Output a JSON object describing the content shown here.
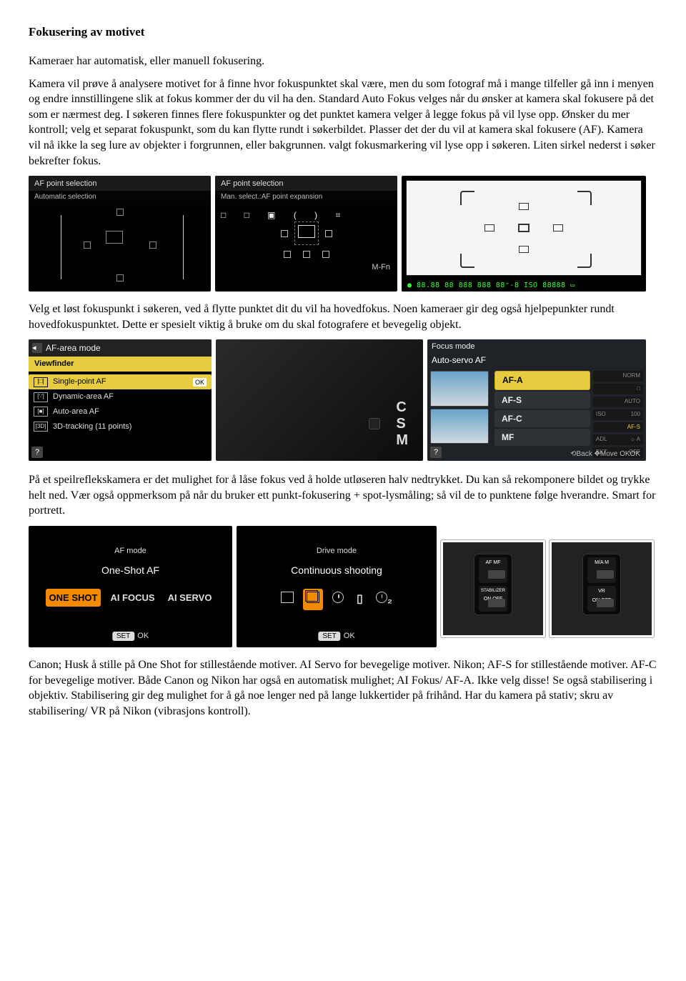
{
  "title": "Fokusering av motivet",
  "p1": "Kameraer har automatisk, eller manuell fokusering.",
  "p2": "Kamera vil prøve å analysere motivet for å finne hvor fokuspunktet skal være, men du som fotograf må i mange tilfeller gå inn i menyen og endre innstillingene slik at fokus kommer der du vil ha den. Standard Auto Fokus velges når du ønsker at kamera skal fokusere på det som er nærmest deg. I søkeren finnes flere fokuspunkter og det punktet kamera velger å legge fokus på vil lyse opp. Ønsker du mer kontroll; velg et separat fokuspunkt, som du kan flytte rundt i søkerbildet. Plasser det der du vil at kamera skal fokusere (AF). Kamera vil nå ikke la seg lure av objekter i forgrunnen, eller bakgrunnen. valgt fokusmarkering vil lyse opp i søkeren. Liten sirkel nederst i søker bekrefter fokus.",
  "p3": "Velg et løst fokuspunkt i søkeren, ved å flytte punktet dit du vil ha hovedfokus. Noen kameraer gir deg også hjelpepunkter rundt hovedfokuspunktet. Dette er spesielt viktig å bruke om du skal fotografere et bevegelig objekt.",
  "p4": "På et speilreflekskamera er det mulighet for å låse fokus ved å holde utløseren halv nedtrykket. Du kan så rekomponere bildet og trykke helt ned. Vær også oppmerksom på når du bruker ett punkt-fokusering + spot-lysmåling; så vil de to punktene følge hverandre. Smart for portrett.",
  "p5": "Canon; Husk å stille på One Shot for stillestående motiver. AI Servo for bevegelige motiver. Nikon; AF-S for stillestående motiver. AF-C for bevegelige motiver. Både Canon og Nikon har også en automatisk mulighet; AI Fokus/ AF-A. Ikke velg disse! Se også stabilisering i objektiv. Stabilisering gir deg mulighet for å gå noe lenger ned på lange lukkertider på frihånd. Har du kamera på stativ; skru av stabilisering/ VR på Nikon (vibrasjons kontroll).",
  "panels": {
    "afsel_auto": {
      "title": "AF point selection",
      "sub": "Automatic selection"
    },
    "afsel_manual": {
      "title": "AF point selection",
      "sub": "Man. select.:AF point expansion",
      "mfn": "M-Fn"
    },
    "afsel_bar": "□  □  ▣  ( )  ⌗",
    "viewfinder_readout": "● 88.88 88 888 888 88⁺-8 ISO 88888 ▭",
    "afarea": {
      "title": "AF-area mode",
      "crumb": "Viewfinder",
      "items": [
        {
          "icon": "[□]",
          "label": "Single-point AF",
          "hl": true,
          "ok": "OK"
        },
        {
          "icon": "[∵]",
          "label": "Dynamic-area AF"
        },
        {
          "icon": "[■]",
          "label": "Auto-area AF"
        },
        {
          "icon": "[3D]",
          "label": "3D-tracking (11 points)"
        }
      ]
    },
    "lensdial": [
      "C",
      "S",
      "M"
    ],
    "focusmode": {
      "title": "Focus mode",
      "sub": "Auto-servo AF",
      "opts": [
        "AF-A",
        "AF-S",
        "AF-C",
        "MF"
      ],
      "sel": 0,
      "side": [
        {
          "l": "",
          "r": "NORM"
        },
        {
          "l": "",
          "r": "□"
        },
        {
          "l": "",
          "r": "AUTO"
        },
        {
          "l": "ISO",
          "r": "100"
        },
        {
          "l": "",
          "r": "AF-S",
          "on": true
        },
        {
          "l": "ADL",
          "r": "☼ A"
        },
        {
          "l": "BKT",
          "r": "OFF"
        }
      ],
      "ftr": "⟲Back  ✥Move  OKOK"
    },
    "afmode": {
      "title": "AF mode",
      "value": "One-Shot AF",
      "opts": [
        "ONE SHOT",
        "AI FOCUS",
        "AI SERVO"
      ],
      "sel": 0,
      "set": "SET",
      "ok": "OK"
    },
    "drivemode": {
      "title": "Drive mode",
      "value": "Continuous shooting",
      "set": "SET",
      "ok": "OK"
    },
    "lens_switch_a": {
      "top": "AF  MF",
      "mid": "STABILIZER",
      "bot": "ON  OFF"
    },
    "lens_switch_b": {
      "top": "M/A  M",
      "mid": "VR",
      "bot": "ON  OFF"
    }
  }
}
